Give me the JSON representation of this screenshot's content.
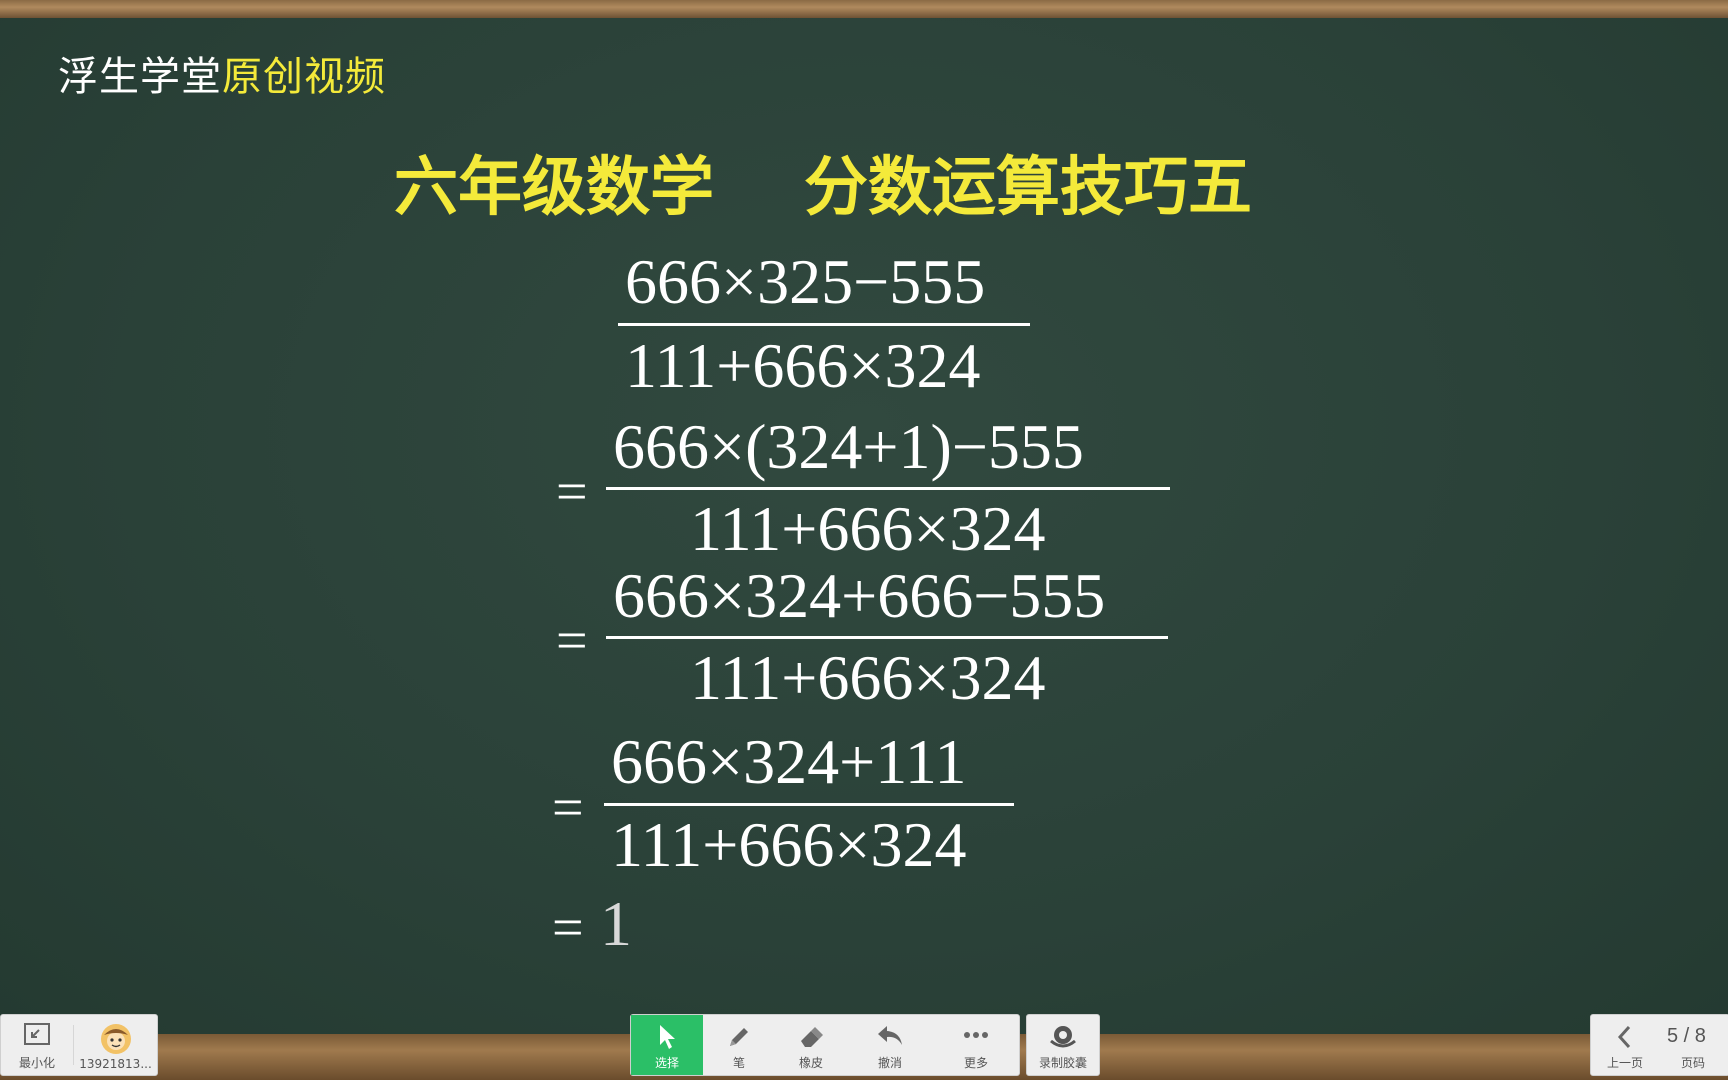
{
  "brand": {
    "part1": "浮生学堂",
    "part2": "原创视频"
  },
  "title": {
    "left": "六年级数学",
    "right": "分数运算技巧五"
  },
  "math": {
    "f1_num": "666×325−555",
    "f1_den": "111+666×324",
    "f2_num": "666×(324+1)−555",
    "f2_den": "111+666×324",
    "f3_num": "666×324+666−555",
    "f3_den": "111+666×324",
    "f4_num": "666×324+111",
    "f4_den": "111+666×324",
    "equals": "=",
    "result": "1"
  },
  "toolbar": {
    "minimize_label": "最小化",
    "user_label": "13921813...",
    "select_label": "选择",
    "pen_label": "笔",
    "eraser_label": "橡皮",
    "undo_label": "撤消",
    "more_label": "更多",
    "record_label": "录制胶囊",
    "prev_label": "上一页",
    "page_label": "页码",
    "page_indicator": "5 / 8"
  },
  "colors": {
    "board": "#2a4239",
    "accent_yellow": "#f4ea3a",
    "active_green": "#2bbf67"
  },
  "icons": [
    "minimize-icon",
    "avatar",
    "cursor-icon",
    "pen-icon",
    "eraser-icon",
    "undo-icon",
    "more-icon",
    "record-icon",
    "chevron-left-icon"
  ]
}
